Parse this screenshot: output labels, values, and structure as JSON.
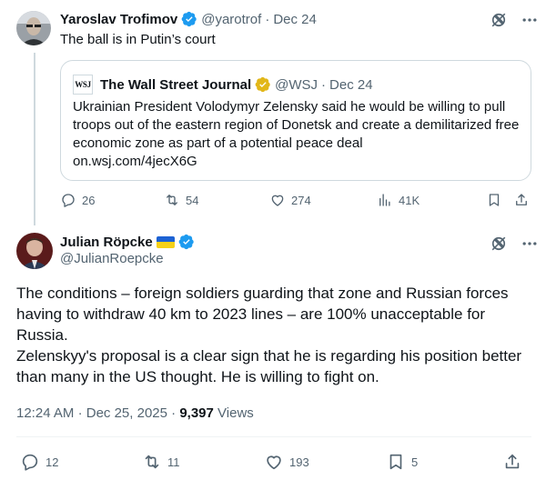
{
  "tweet1": {
    "name": "Yaroslav Trofimov",
    "handle": "@yarotrof",
    "sep": "·",
    "date": "Dec 24",
    "text": "The ball is in Putin’s court",
    "quote": {
      "logo_text": "WSJ",
      "name": "The Wall Street Journal",
      "handle": "@WSJ",
      "sep": "·",
      "date": "Dec 24",
      "text": "Ukrainian President Volodymyr Zelensky said he would be willing to pull troops out of the eastern region of Donetsk and create a demilitarized free economic zone as part of a potential peace deal",
      "link": "on.wsj.com/4jecX6G"
    },
    "stats": {
      "replies": "26",
      "reposts": "54",
      "likes": "274",
      "views": "41K"
    }
  },
  "tweet2": {
    "name": "Julian Röpcke",
    "handle": "@JulianRoepcke",
    "body_lines": [
      "The conditions – foreign soldiers guarding that zone and Russian forces having to withdraw 40 km to 2023 lines – are 100% unacceptable for Russia.",
      "Zelenskyy's proposal is a clear sign that he is regarding his position better than many in the US thought. He is willing to fight on."
    ],
    "time": "12:24 AM",
    "sep": "·",
    "date": "Dec 25, 2025",
    "views_count": "9,397",
    "views_label": "Views",
    "stats": {
      "replies": "12",
      "reposts": "11",
      "likes": "193",
      "bookmarks": "5"
    }
  },
  "colors": {
    "verified_blue": "#1d9bf0",
    "verified_gold": "#e2b719",
    "muted": "#536471",
    "text": "#0f1419",
    "border": "#cfd9de"
  },
  "icons": [
    "grok-icon",
    "more-icon",
    "reply-icon",
    "repost-icon",
    "like-icon",
    "views-icon",
    "bookmark-icon",
    "share-icon",
    "verified-badge-icon",
    "ukraine-flag-icon"
  ]
}
